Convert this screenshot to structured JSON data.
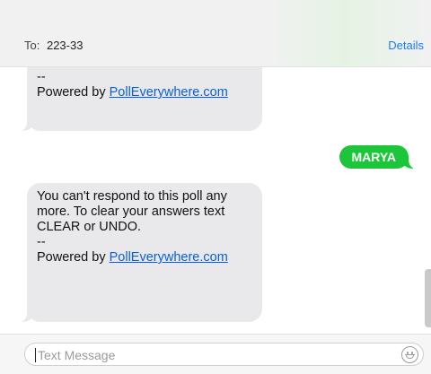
{
  "header": {
    "to_label": "To:",
    "recipient": "223-33",
    "details_label": "Details"
  },
  "messages": [
    {
      "direction": "incoming",
      "text_partial_top": "--",
      "powered_prefix": "Powered by ",
      "link_text": "PollEverywhere.com"
    },
    {
      "direction": "outgoing",
      "text": "MARYA"
    },
    {
      "direction": "incoming",
      "text": "You can't respond to this poll any more. To clear your answers text CLEAR or UNDO.\n--",
      "powered_prefix": "Powered by ",
      "link_text": "PollEverywhere.com"
    }
  ],
  "composer": {
    "placeholder": "Text Message",
    "value": ""
  },
  "icons": {
    "emoji": "emoji-smiley-icon"
  },
  "colors": {
    "incoming_bubble": "#e9e9eb",
    "outgoing_bubble": "#1cc53a",
    "link": "#0a5fd6",
    "details_link": "#1d7cf2"
  }
}
